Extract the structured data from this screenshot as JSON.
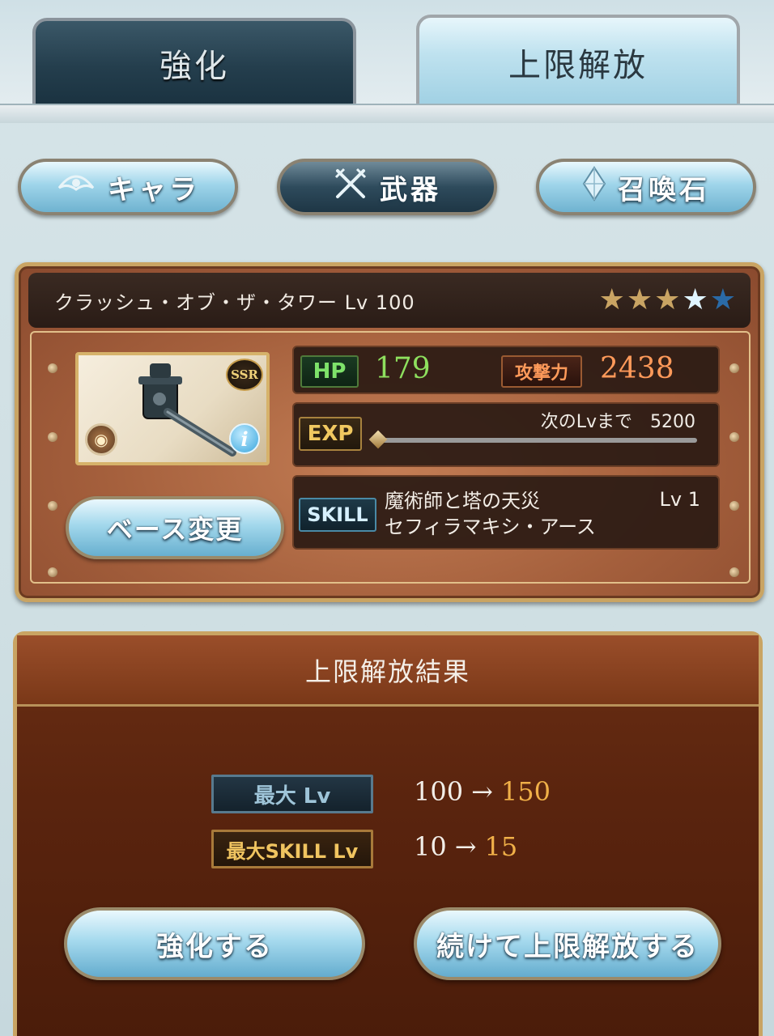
{
  "tabs": {
    "enhance": "強化",
    "uncap": "上限解放"
  },
  "categories": {
    "chara": "キャラ",
    "weapon": "武器",
    "summon": "召喚石"
  },
  "item": {
    "name": "クラッシュ・オブ・ザ・タワー Lv 100",
    "rarity": "SSR",
    "hp_label": "HP",
    "hp": "179",
    "atk_label": "攻撃力",
    "atk": "2438",
    "exp_label": "EXP",
    "next_lv": "次のLvまで　5200",
    "exp_progress": 0,
    "skill_label": "SKILL",
    "skill_name_1": "魔術師と塔の天災",
    "skill_name_2": "セフィラマキシ・アース",
    "skill_lv": "Lv  1",
    "base_change": "ベース変更",
    "stars_filled": 3,
    "stars_total": 5
  },
  "result": {
    "title": "上限解放結果",
    "max_lv_label": "最大 Lv",
    "max_lv_from": "100",
    "max_lv_arrow": "→",
    "max_lv_to": "150",
    "max_skill_label": "最大SKILL Lv",
    "max_skill_from": "10",
    "max_skill_arrow": "→",
    "max_skill_to": "15",
    "enhance_button": "強化する",
    "continue_button": "続けて上限解放する"
  },
  "colors": {
    "hp": "#8ee05e",
    "atk": "#ff9a5a",
    "upgrade": "#f0b048"
  }
}
